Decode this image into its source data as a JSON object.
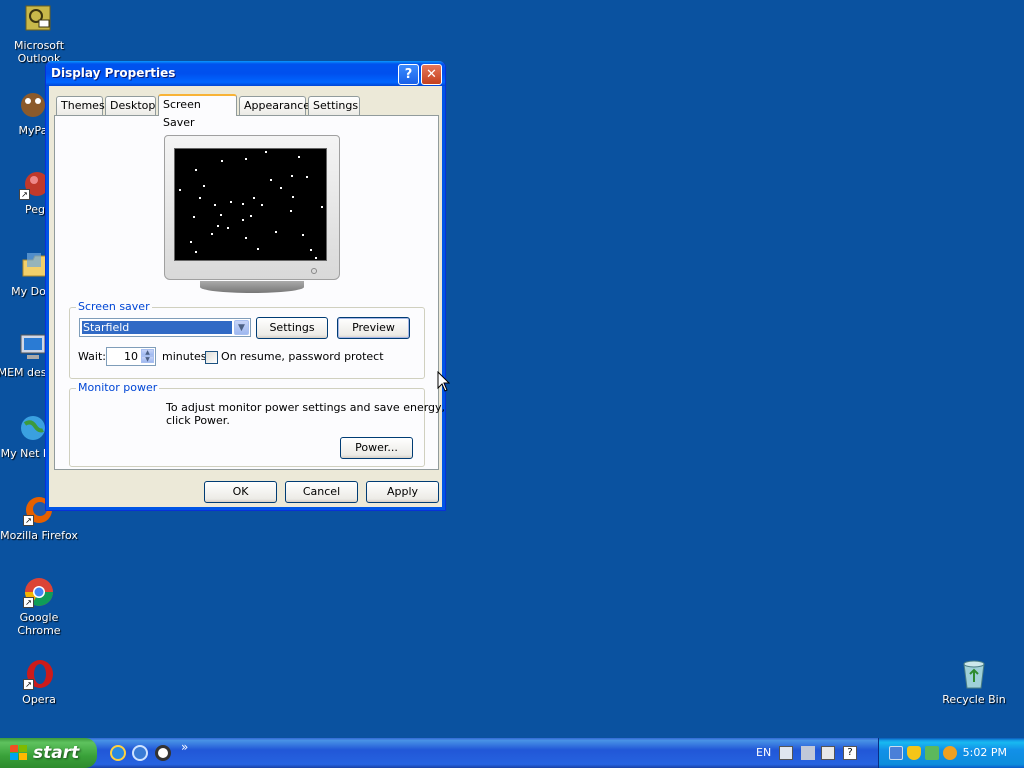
{
  "desktop": {
    "icons": [
      {
        "label": "Microsoft Outlook",
        "color": "#b4a53c"
      },
      {
        "label": "MyPa",
        "color": "#8b5a2b"
      },
      {
        "label": "Peg",
        "color": "#c0392b"
      },
      {
        "label": "My Docu",
        "color": "#f2d06b"
      },
      {
        "label": "MEM destruc",
        "color": "#d0d8e8"
      },
      {
        "label": "My Net Plac",
        "color": "#3aa0e0"
      },
      {
        "label": "Mozilla Firefox",
        "color": "#e66000"
      },
      {
        "label": "Google Chrome",
        "color": "#4285f4"
      },
      {
        "label": "Opera",
        "color": "#cc1b1b"
      },
      {
        "label": "Recycle Bin",
        "color": "#9fd0d8"
      }
    ]
  },
  "dialog": {
    "title": "Display Properties",
    "help_glyph": "?",
    "close_glyph": "✕",
    "tabs": [
      "Themes",
      "Desktop",
      "Screen Saver",
      "Appearance",
      "Settings"
    ],
    "active_tab": "Screen Saver",
    "screensaver": {
      "group_label": "Screen saver",
      "selected": "Starfield",
      "settings_label": "Settings",
      "preview_label": "Preview",
      "wait_label": "Wait:",
      "wait_value": "10",
      "minutes_label": "minutes",
      "password_label": "On resume, password protect",
      "password_checked": false
    },
    "monitor_power": {
      "group_label": "Monitor power",
      "description_line1": "To adjust monitor power settings and save energy,",
      "description_line2": "click Power.",
      "power_label": "Power..."
    },
    "buttons": {
      "ok": "OK",
      "cancel": "Cancel",
      "apply": "Apply"
    }
  },
  "taskbar": {
    "start_label": "start",
    "quick_launch": [
      "internet-explorer-icon",
      "outlook-express-icon",
      "media-player-icon"
    ],
    "chevron": "»",
    "lang": "EN",
    "clock": "5:02 PM"
  },
  "colors": {
    "desktop": "#0a52a0",
    "titlebar": "#0053ee",
    "dialog_bg": "#ece9d8",
    "selection": "#316ac5",
    "group_label": "#0046d5"
  }
}
